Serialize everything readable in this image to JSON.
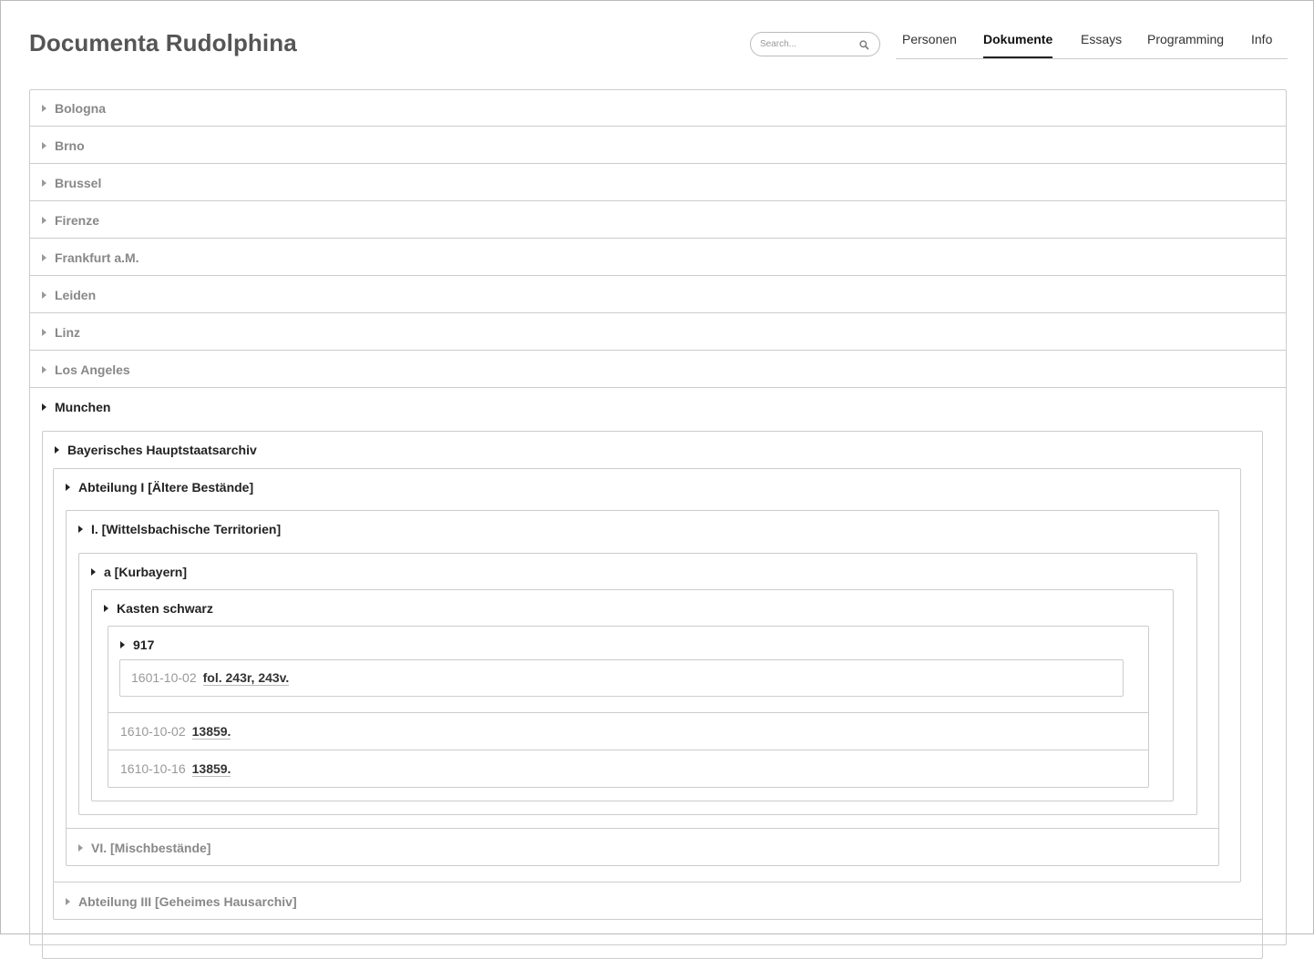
{
  "header": {
    "title": "Documenta Rudolphina",
    "search_placeholder": "Search...",
    "nav": [
      "Personen",
      "Dokumente",
      "Essays",
      "Programming",
      "Info"
    ],
    "active_tab": "Dokumente"
  },
  "places": [
    "Bologna",
    "Brno",
    "Brussel",
    "Firenze",
    "Frankfurt a.M.",
    "Leiden",
    "Linz",
    "Los Angeles",
    "Munchen"
  ],
  "munchen": {
    "archive": "Bayerisches Hauptstaatsarchiv",
    "abteilung_1": "Abteilung I [Ältere Bestände]",
    "section_1": "I. [Wittelsbachische Territorien]",
    "subsection_a": "a [Kurbayern]",
    "kasten": "Kasten schwarz",
    "volume": "917",
    "volume_doc": {
      "date": "1601-10-02",
      "ref": "fol. 243r, 243v."
    },
    "docs": [
      {
        "date": "1610-10-02",
        "ref": "13859."
      },
      {
        "date": "1610-10-16",
        "ref": "13859."
      }
    ],
    "section_6": "VI. [Mischbestände]",
    "abteilung_3": "Abteilung III [Geheimes Hausarchiv]"
  }
}
